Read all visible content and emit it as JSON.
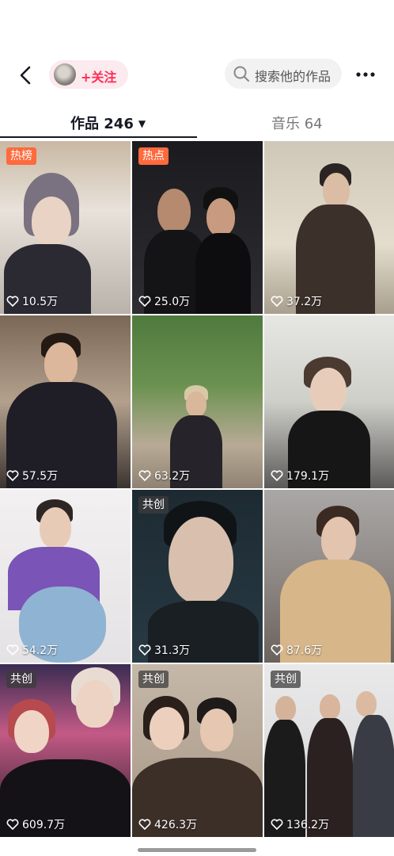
{
  "header": {
    "follow_label": "+关注",
    "search_placeholder": "搜索他的作品"
  },
  "tabs": {
    "works_label": "作品 246",
    "music_label": "音乐 64"
  },
  "videos": [
    {
      "badge": "热榜",
      "likes": "10.5万"
    },
    {
      "badge": "热点",
      "likes": "25.0万"
    },
    {
      "badge": "",
      "likes": "37.2万"
    },
    {
      "badge": "",
      "likes": "57.5万"
    },
    {
      "badge": "",
      "likes": "63.2万"
    },
    {
      "badge": "",
      "likes": "179.1万"
    },
    {
      "badge": "",
      "likes": "54.2万"
    },
    {
      "badge": "共创",
      "likes": "31.3万"
    },
    {
      "badge": "",
      "likes": "87.6万"
    },
    {
      "badge": "共创",
      "likes": "609.7万"
    },
    {
      "badge": "共创",
      "likes": "426.3万"
    },
    {
      "badge": "共创",
      "likes": "136.2万"
    }
  ],
  "icons": {
    "back": "chevron-left-icon",
    "search": "search-icon",
    "more": "more-dots-icon",
    "like": "heart-icon",
    "tab_caret": "caret-down-icon"
  },
  "colors": {
    "accent": "#fe2c55",
    "hot_badge": "#ff6a3d"
  }
}
